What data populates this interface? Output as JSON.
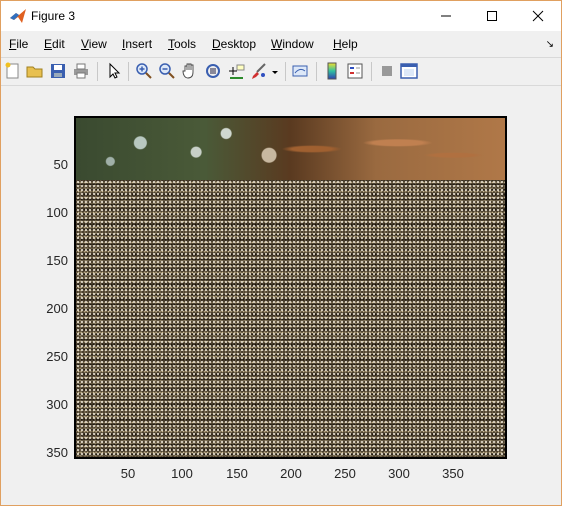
{
  "window": {
    "title": "Figure 3"
  },
  "menu": {
    "items": [
      {
        "key": "F",
        "rest": "ile"
      },
      {
        "key": "E",
        "rest": "dit"
      },
      {
        "key": "V",
        "rest": "iew"
      },
      {
        "key": "I",
        "rest": "nsert"
      },
      {
        "key": "T",
        "rest": "ools"
      },
      {
        "key": "D",
        "rest": "esktop"
      },
      {
        "key": "W",
        "rest": "indow"
      },
      {
        "key": "H",
        "rest": "elp"
      }
    ]
  },
  "toolbar": {
    "icons": [
      "new-figure",
      "open-file",
      "save",
      "print",
      "select-arrow",
      "zoom-in",
      "zoom-out",
      "pan",
      "rotate-3d",
      "data-cursor",
      "brush",
      "brush-dropdown",
      "link-plot",
      "colorbar",
      "legend",
      "hide-plot-tools",
      "show-plot-tools"
    ]
  },
  "axes": {
    "yticks": [
      "50",
      "100",
      "150",
      "200",
      "250",
      "300",
      "350"
    ],
    "xticks": [
      "50",
      "100",
      "150",
      "200",
      "250",
      "300",
      "350"
    ]
  }
}
